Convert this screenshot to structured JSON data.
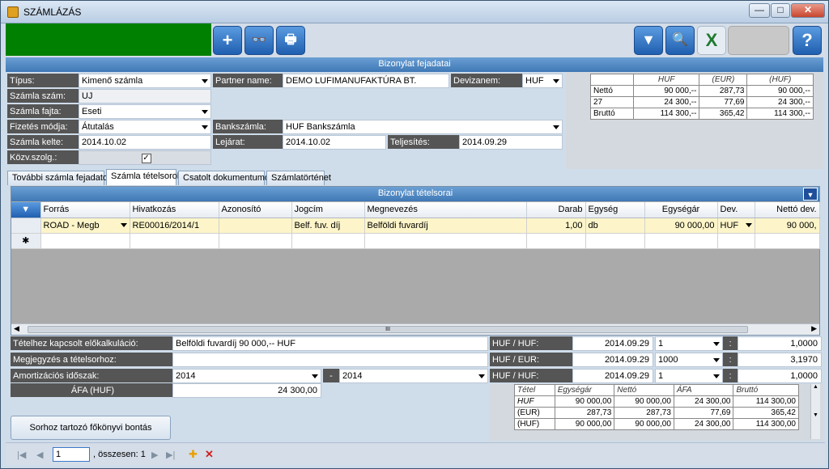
{
  "window": {
    "title": "SZÁMLÁZÁS",
    "min": "—",
    "max": "□",
    "close": "✕"
  },
  "toolbar": {
    "add": "+",
    "view": "👓",
    "print": "🖶",
    "filter": "▼",
    "search": "🔍",
    "excel": "X",
    "help": "?"
  },
  "header": {
    "section_title": "Bizonylat fejadatai",
    "tipus_label": "Típus:",
    "tipus_value": "Kimenő számla",
    "szamla_szam_label": "Számla szám:",
    "szamla_szam_value": "UJ",
    "szamla_fajta_label": "Számla fajta:",
    "szamla_fajta_value": "Eseti",
    "fizetes_label": "Fizetés módja:",
    "fizetes_value": "Átutalás",
    "kelte_label": "Számla kelte:",
    "kelte_value": "2014.10.02",
    "kozv_label": "Közv.szolg.:",
    "kozv_check": "✓",
    "partner_label": "Partner name:",
    "partner_value": "DEMO LUFIMANUFAKTÚRA BT.",
    "deviza_label": "Devizanem:",
    "deviza_value": "HUF",
    "bank_label": "Bankszámla:",
    "bank_value": "HUF Bankszámla",
    "lejarat_label": "Lejárat:",
    "lejarat_value": "2014.10.02",
    "teljesites_label": "Teljesítés:",
    "teljesites_value": "2014.09.29"
  },
  "summary": {
    "headers": [
      "",
      "HUF",
      "(EUR)",
      "(HUF)"
    ],
    "rows": [
      [
        "Nettó",
        "90 000,--",
        "287,73",
        "90 000,--"
      ],
      [
        "27",
        "24 300,--",
        "77,69",
        "24 300,--"
      ],
      [
        "Bruttó",
        "114 300,--",
        "365,42",
        "114 300,--"
      ]
    ]
  },
  "tabs": [
    "További számla fejadatok",
    "Számla tételsorok",
    "Csatolt dokumentumok",
    "Számlatörténet"
  ],
  "lines": {
    "section_title": "Bizonylat tételsorai",
    "columns": [
      "Forrás",
      "Hivatkozás",
      "Azonosító",
      "Jogcím",
      "Megnevezés",
      "Darab",
      "Egység",
      "Egységár",
      "Dev.",
      "Nettó dev."
    ],
    "row": [
      "ROAD - Megb",
      "RE00016/2014/1",
      "",
      "Belf. fuv. díj",
      "Belföldi fuvardíj",
      "1,00",
      "db",
      "90 000,00",
      "HUF",
      "90 000,"
    ],
    "new_marker": "✱",
    "scroll_mid": "III"
  },
  "bottom": {
    "elokalk_label": "Tételhez kapcsolt előkalkuláció:",
    "elokalk_value": "Belföldi fuvardíj 90 000,-- HUF",
    "megj_label": "Megjegyzés a tételsorhoz:",
    "megj_value": "",
    "amort_label": "Amortizációs időszak:",
    "amort_from": "2014",
    "amort_sep": "-",
    "amort_to": "2014",
    "afa_label": "ÁFA (HUF)",
    "afa_value": "24 300,00",
    "konyv_button": "Sorhoz tartozó főkönyvi bontás"
  },
  "rates": [
    {
      "label": "HUF / HUF:",
      "date": "2014.09.29",
      "unit": "1",
      "sep": ":",
      "rate": "1,0000"
    },
    {
      "label": "HUF / EUR:",
      "date": "2014.09.29",
      "unit": "1000",
      "sep": ":",
      "rate": "3,1970"
    },
    {
      "label": "HUF / HUF:",
      "date": "2014.09.29",
      "unit": "1",
      "sep": ":",
      "rate": "1,0000"
    }
  ],
  "rate_summary": {
    "headers": [
      "Tétel",
      "Egységár",
      "Nettó",
      "ÁFA",
      "Bruttó"
    ],
    "rows": [
      [
        "HUF",
        "90 000,00",
        "90 000,00",
        "24 300,00",
        "114 300,00"
      ],
      [
        "(EUR)",
        "287,73",
        "287,73",
        "77,69",
        "365,42"
      ],
      [
        "(HUF)",
        "90 000,00",
        "90 000,00",
        "24 300,00",
        "114 300,00"
      ]
    ]
  },
  "nav": {
    "first": "|◀",
    "prev": "◀",
    "page": "1",
    "total": ", összesen: 1",
    "next": "▶",
    "last": "▶|",
    "add": "✚",
    "delete": "✕"
  }
}
